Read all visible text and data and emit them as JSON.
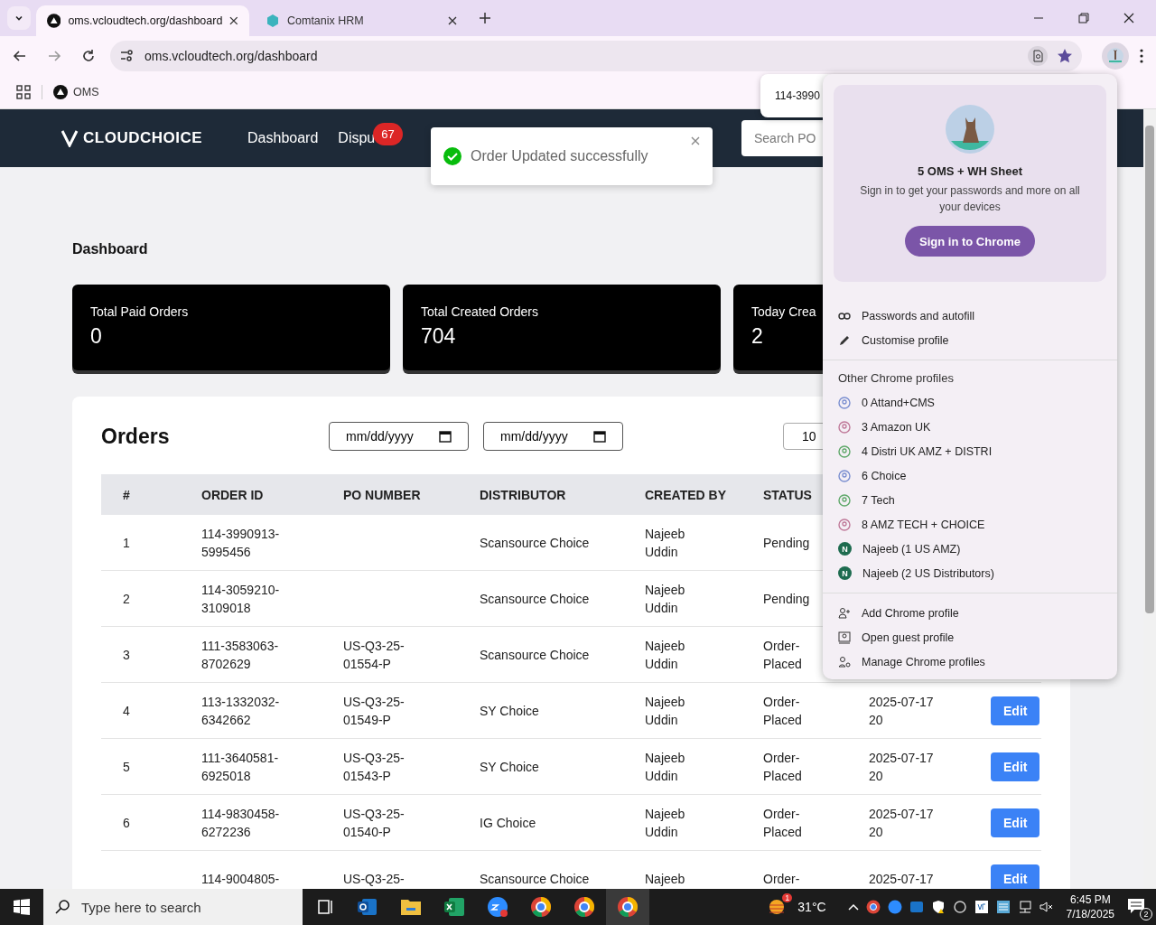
{
  "browser": {
    "tabs": [
      {
        "title": "oms.vcloudtech.org/dashboard",
        "kind": "triangle",
        "selected": true
      },
      {
        "title": "Comtanix HRM",
        "kind": "hexagon",
        "selected": false
      }
    ],
    "address": "oms.vcloudtech.org/dashboard",
    "bookmarks": [
      {
        "label": "OMS"
      }
    ],
    "find_bar": {
      "query": "114-3990"
    }
  },
  "navbar": {
    "logo": "CLOUDCHOICE",
    "links": [
      {
        "label": "Dashboard"
      },
      {
        "label": "Dispu",
        "badge": "67"
      }
    ],
    "search": {
      "placeholder": "Search PO"
    }
  },
  "toast": {
    "message": "Order Updated successfully"
  },
  "page_title": "Dashboard",
  "stat_cards": [
    {
      "label": "Total Paid Orders",
      "value": "0"
    },
    {
      "label": "Total Created Orders",
      "value": "704"
    },
    {
      "label": "Today Crea",
      "value": "2"
    }
  ],
  "orders": {
    "title": "Orders",
    "date_from": {
      "value": "mm/dd/yyyy"
    },
    "date_to": {
      "value": "mm/dd/yyyy"
    },
    "page_size": "10",
    "columns": [
      "#",
      "ORDER ID",
      "PO NUMBER",
      "DISTRIBUTOR",
      "CREATED BY",
      "STATUS"
    ],
    "rows": [
      {
        "n": "1",
        "order_id": "114-3990913-5995456",
        "distributor": "Scansource Choice",
        "created_by": "Najeeb Uddin",
        "status": "Pending"
      },
      {
        "n": "2",
        "order_id": "114-3059210-3109018",
        "distributor": "Scansource Choice",
        "created_by": "Najeeb Uddin",
        "status": "Pending"
      },
      {
        "n": "3",
        "order_id": "111-3583063-8702629",
        "po": "US-Q3-25-01554-P",
        "distributor": "Scansource Choice",
        "created_by": "Najeeb Uddin",
        "status": "Order-Placed"
      },
      {
        "n": "4",
        "order_id": "113-1332032-6342662",
        "po": "US-Q3-25-01549-P",
        "distributor": "SY Choice",
        "created_by": "Najeeb Uddin",
        "status": "Order-Placed",
        "created_at": "2025-07-17 20",
        "action": "Edit"
      },
      {
        "n": "5",
        "order_id": "111-3640581-6925018",
        "po": "US-Q3-25-01543-P",
        "distributor": "SY Choice",
        "created_by": "Najeeb Uddin",
        "status": "Order-Placed",
        "created_at": "2025-07-17 20",
        "action": "Edit"
      },
      {
        "n": "6",
        "order_id": "114-9830458-6272236",
        "po": "US-Q3-25-01540-P",
        "distributor": "IG Choice",
        "created_by": "Najeeb Uddin",
        "status": "Order-Placed",
        "created_at": "2025-07-17 20",
        "action": "Edit"
      },
      {
        "order_id": "114-9004805-",
        "po": "US-Q3-25-",
        "distributor": "Scansource Choice",
        "created_by": "Najeeb",
        "status": "Order-",
        "created_at": "2025-07-17",
        "action": "Edit"
      }
    ]
  },
  "profile_menu": {
    "name": "5 OMS + WH Sheet",
    "message": "Sign in to get your passwords and more on all your devices",
    "sign_in_button": "Sign in to Chrome",
    "actions": [
      {
        "label": "Passwords and autofill",
        "kind": "key"
      },
      {
        "label": "Customise profile",
        "kind": "pencil"
      }
    ],
    "other_heading": "Other Chrome profiles",
    "profiles": [
      {
        "name": "0 Attand+CMS",
        "kind": "generic",
        "color": "#7b8fd0"
      },
      {
        "name": "3 Amazon UK",
        "kind": "generic",
        "color": "#c07a9a"
      },
      {
        "name": "4 Distri UK AMZ + DISTRI",
        "kind": "generic",
        "color": "#5fa86a"
      },
      {
        "name": "6 Choice",
        "kind": "generic",
        "color": "#7b8fd0"
      },
      {
        "name": "7 Tech",
        "kind": "generic",
        "color": "#5fa86a"
      },
      {
        "name": "8 AMZ TECH + CHOICE",
        "kind": "generic",
        "color": "#c07a9a"
      },
      {
        "name": "Najeeb (1 US AMZ)",
        "kind": "letter",
        "initial": "N",
        "color": "#1e6b4f"
      },
      {
        "name": "Najeeb (2 US Distributors)",
        "kind": "letter",
        "initial": "N",
        "color": "#1e6b4f"
      }
    ],
    "footer_actions": [
      {
        "label": "Add Chrome profile",
        "kind": "add"
      },
      {
        "label": "Open guest profile",
        "kind": "guest"
      },
      {
        "label": "Manage Chrome profiles",
        "kind": "manage"
      }
    ]
  },
  "taskbar": {
    "search_placeholder": "Type here to search",
    "weather": {
      "temp": "31°C",
      "badge": "1"
    },
    "time": "6:45 PM",
    "date": "7/18/2025",
    "notifications": "2"
  }
}
